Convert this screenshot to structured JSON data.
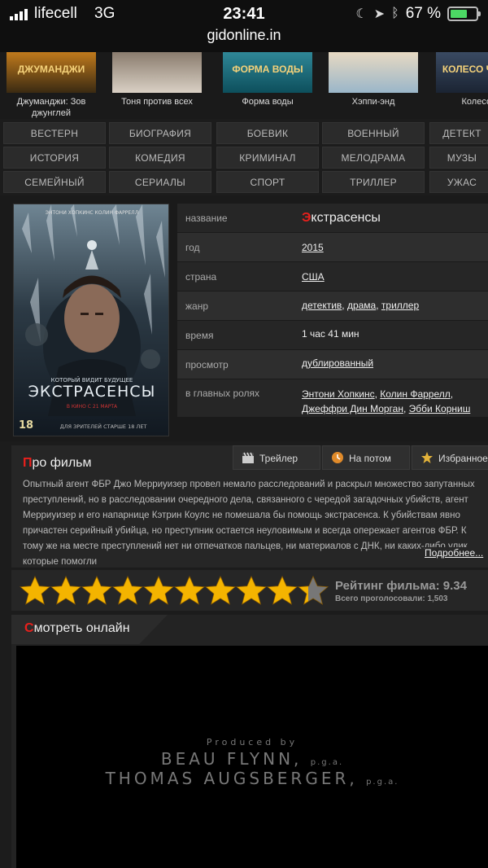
{
  "status": {
    "carrier": "lifecell",
    "network": "3G",
    "time": "23:41",
    "battery": "67 %",
    "battery_level": 0.67
  },
  "browser": {
    "url": "gidonline.in"
  },
  "thumbs": [
    {
      "title": "Джуманджи: Зов джунглей",
      "poster_text": "ДЖУМАНДЖИ",
      "colors": [
        "#3a2a12",
        "#c07a1c"
      ]
    },
    {
      "title": "Тоня против всех",
      "poster_text": "",
      "colors": [
        "#d9d0c4",
        "#8a7c6e"
      ]
    },
    {
      "title": "Форма воды",
      "poster_text": "ФОРМА ВОДЫ",
      "colors": [
        "#0d4f5c",
        "#2f8797"
      ]
    },
    {
      "title": "Хэппи-энд",
      "poster_text": "",
      "colors": [
        "#9ab6c9",
        "#e7d9c2"
      ]
    },
    {
      "title": "Колесо Ч",
      "poster_text": "КОЛЕСО ЧУДЕС",
      "colors": [
        "#1b2433",
        "#3a4a62"
      ]
    }
  ],
  "genres": [
    [
      "ВЕСТЕРН",
      "БИОГРАФИЯ",
      "БОЕВИК",
      "ВОЕННЫЙ",
      "ДЕТЕКТ"
    ],
    [
      "ИСТОРИЯ",
      "КОМЕДИЯ",
      "КРИМИНАЛ",
      "МЕЛОДРАМА",
      "МУЗЫ"
    ],
    [
      "СЕМЕЙНЫЙ",
      "СЕРИАЛЫ",
      "СПОРТ",
      "ТРИЛЛЕР",
      "УЖАС"
    ]
  ],
  "poster": {
    "actors_line": "ЭНТОНИ ХОПКИНС   КОЛИН ФАРРЕЛЛ",
    "tagline": "КОТОРЫЙ ВИДИТ БУДУЩЕЕ",
    "title": "ЭКСТРАСЕНСЫ",
    "release": "В КИНО С 21 МАРТА",
    "age": "18",
    "age_note": "ДЛЯ ЗРИТЕЛЕЙ СТАРШЕ 18 ЛЕТ"
  },
  "info": {
    "title_label": "название",
    "title_first": "Э",
    "title_rest": "кстрасенсы",
    "year_label": "год",
    "year": "2015",
    "country_label": "страна",
    "country": "США",
    "genre_label": "жанр",
    "genres": [
      "детектив",
      "драма",
      "триллер"
    ],
    "time_label": "время",
    "duration": "1 час 41 мин",
    "view_label": "просмотр",
    "view": "дублированный",
    "cast_label": "в главных ролях",
    "cast": [
      "Энтони Хопкинс",
      "Колин Фаррелл",
      "Джеффри Дин Морган",
      "Эбби Корниш"
    ]
  },
  "about": {
    "title_first": "П",
    "title_rest": "ро фильм",
    "tabs": [
      "Трейлер",
      "На потом",
      "Избранное"
    ],
    "description": "Опытный агент ФБР Джо Мерриуизер провел немало расследований и раскрыл множество запутанных преступлений, но в расследовании очередного дела, связанного с чередой загадочных убийств, агент Мерриуизер и его напарнице Кэтрин Коулс не помешала бы помощь экстрасенса. К убийствам явно причастен серийный убийца, но преступник остается неуловимым и всегда опережает агентов ФБР. К тому же на месте преступлений нет ни отпечатков пальцев, ни материалов с ДНК, ни каких-либо улик, которые помогли",
    "more": "Подробнее..."
  },
  "rating": {
    "label": "Рейтинг фильма: 9.34",
    "votes": "Всего проголосовали: 1,503",
    "value": 9.34,
    "max": 10,
    "star_color": "#f4b400"
  },
  "watch": {
    "title_first": "С",
    "title_rest": "мотреть онлайн",
    "credit_1": "Produced by",
    "credit_2": "BEAU FLYNN,",
    "credit_2_suffix": "p.g.a.",
    "credit_3": "THOMAS AUGSBERGER,",
    "credit_3_suffix": "p.g.a."
  }
}
